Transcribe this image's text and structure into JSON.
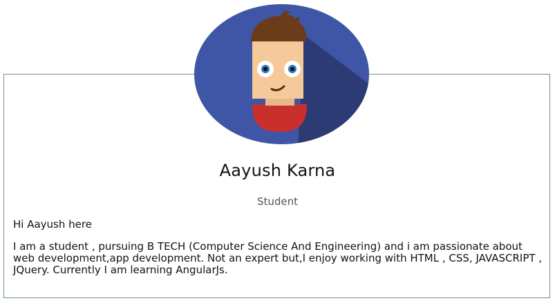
{
  "profile": {
    "name": "Aayush Karna",
    "role": "Student",
    "greeting": "Hi Aayush here",
    "bio": "I am a student , pursuing B TECH (Computer Science And Engineering) and i am passionate about web development,app development. Not an expert but,I enjoy working with HTML , CSS, JAVASCRIPT , JQuery. Currently I am learning AngularJs."
  },
  "avatar": {
    "icon": "cartoon-boy-avatar",
    "background_color": "#3f56a6",
    "shadow_color": "#2c3b74",
    "skin_color": "#f5c99a",
    "hair_color": "#6b3b1a",
    "shirt_color": "#c9302c",
    "eye_color": "#2b7bbd"
  },
  "colors": {
    "card_border": "#6f8fa3",
    "text": "#111111",
    "muted_text": "#555555"
  }
}
